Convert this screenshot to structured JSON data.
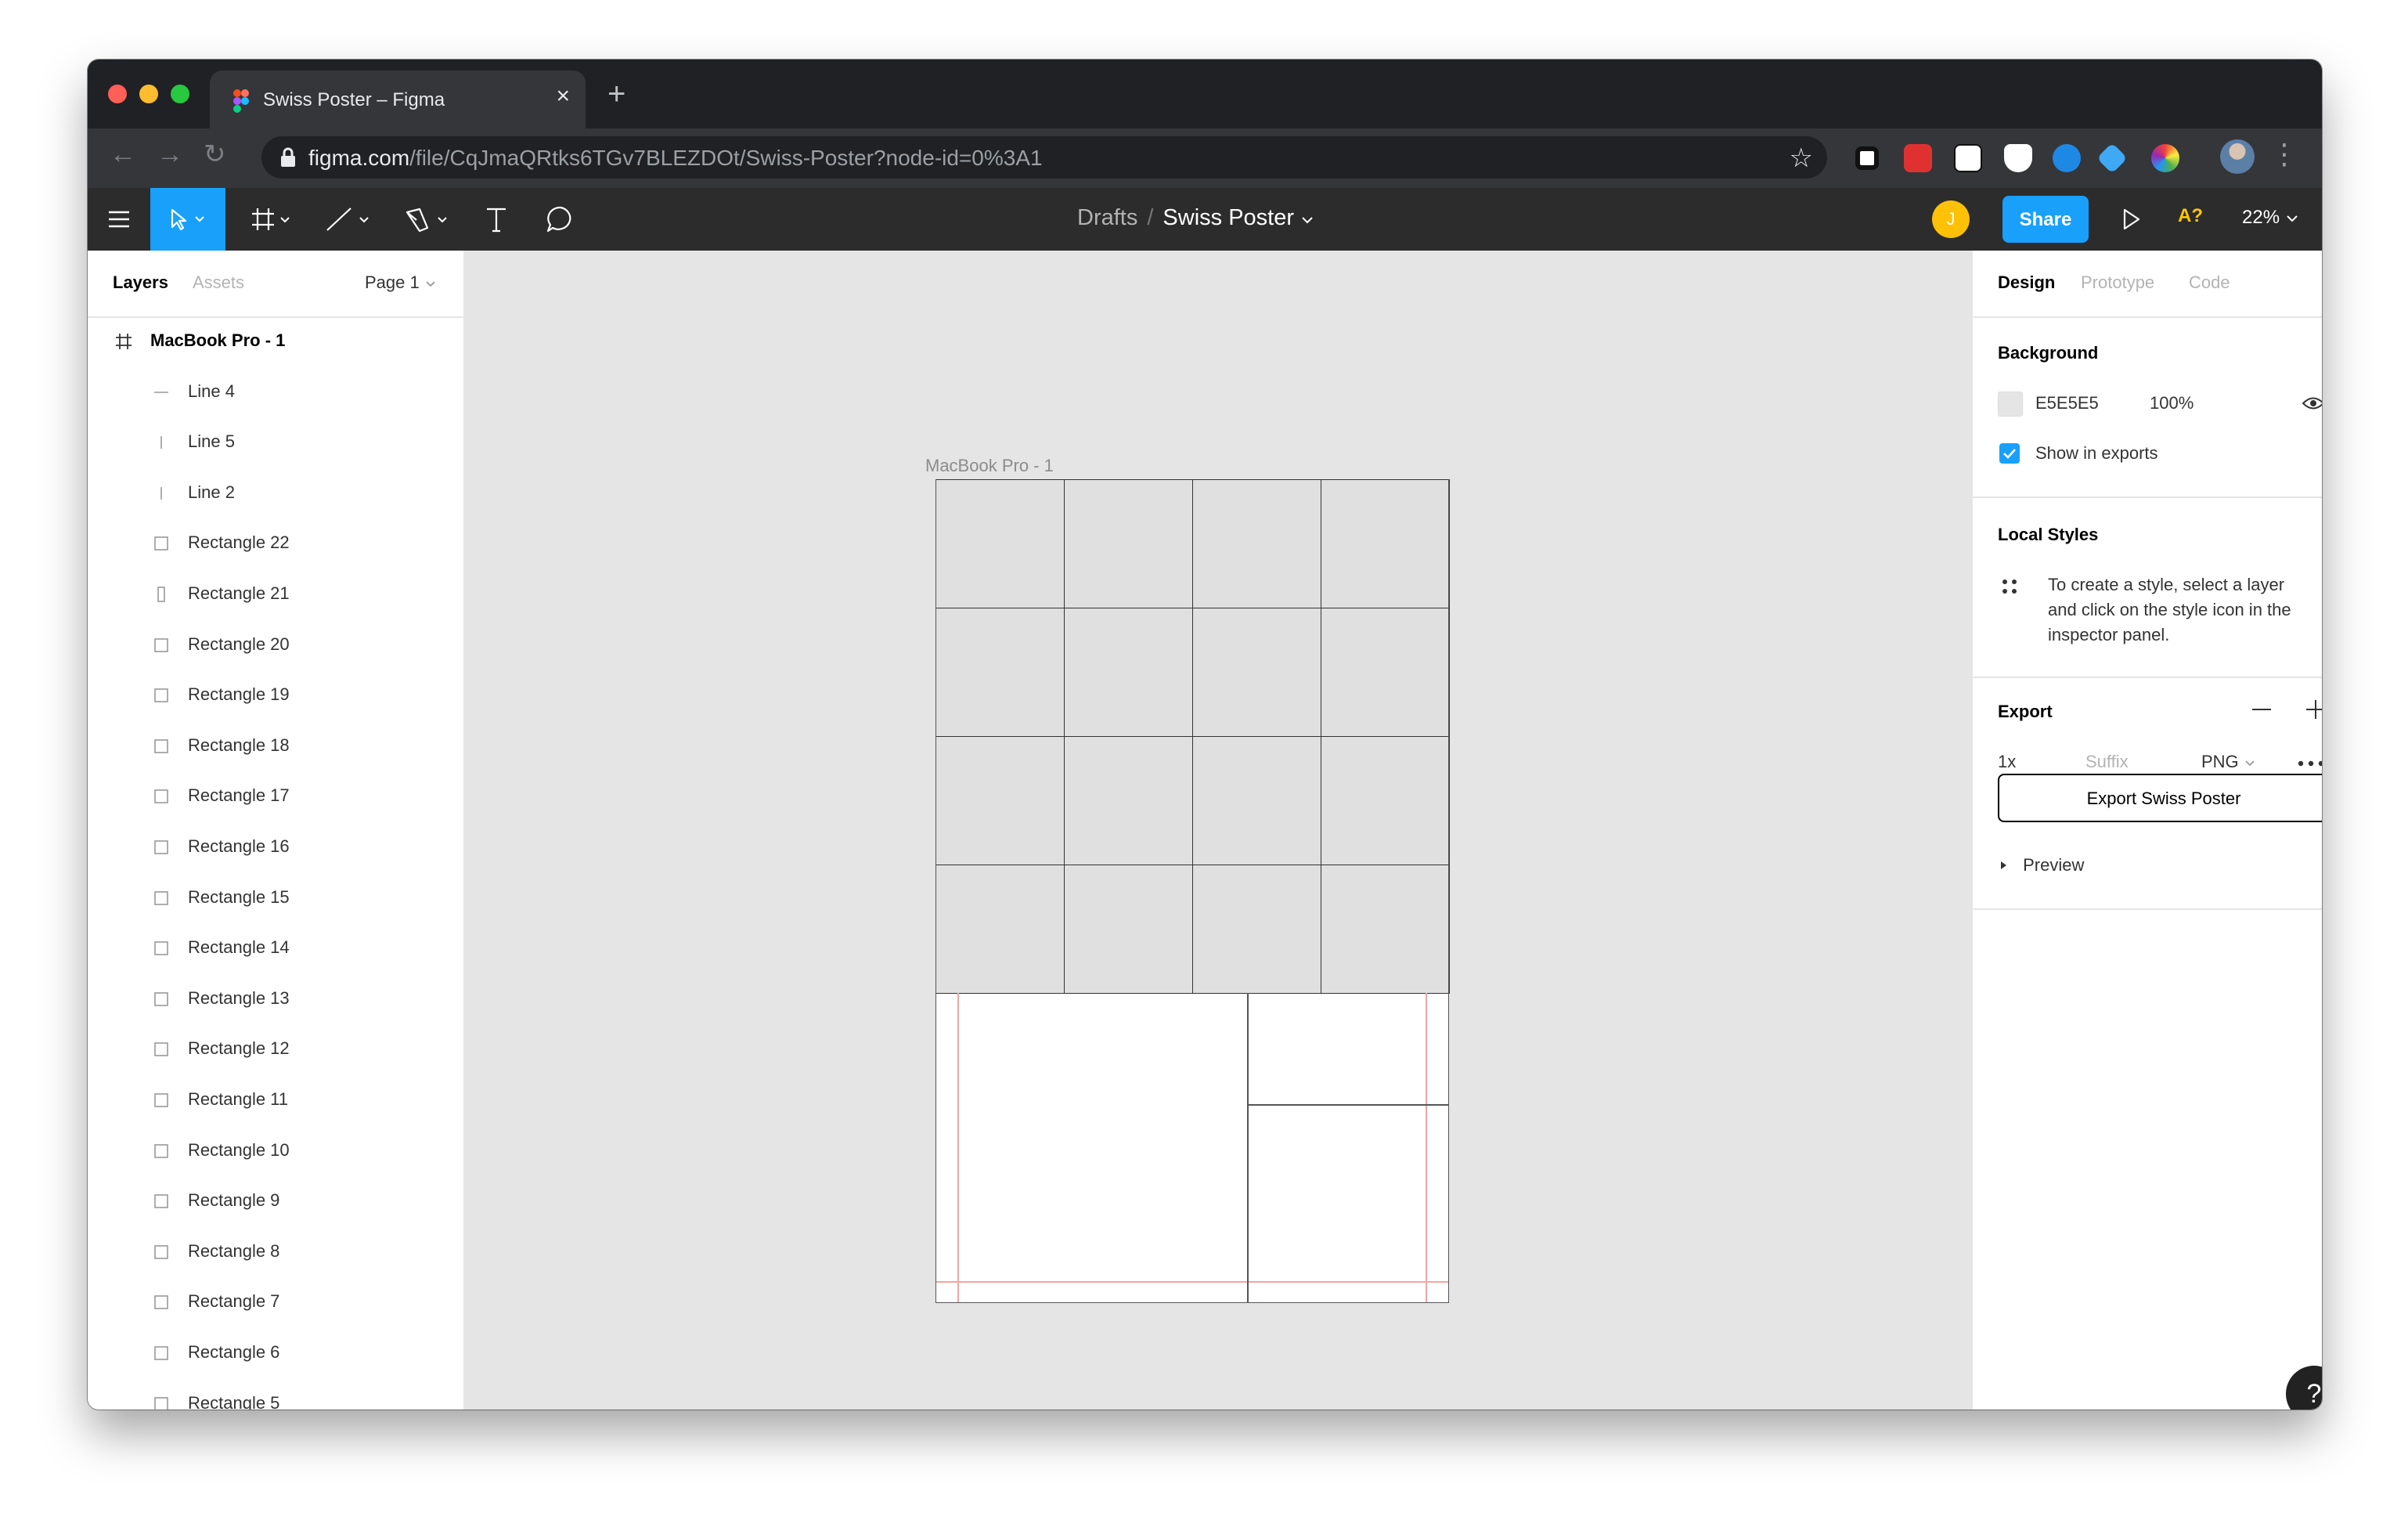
{
  "browser": {
    "tab_title": "Swiss Poster – Figma",
    "url_host": "figma.com",
    "url_path": "/file/CqJmaQRtks6TGv7BLEZDOt/Swiss-Poster?node-id=0%3A1"
  },
  "figma_toolbar": {
    "breadcrumb_parent": "Drafts",
    "breadcrumb_sep": "/",
    "file_name": "Swiss Poster",
    "user_initial": "J",
    "share_label": "Share",
    "missing_font_label": "A?",
    "zoom": "22%"
  },
  "left_panel": {
    "tabs": [
      "Layers",
      "Assets"
    ],
    "page": "Page 1",
    "layers": [
      {
        "label": "MacBook Pro - 1",
        "icon": "frame-icon"
      },
      {
        "label": "Line 4",
        "icon": "horizontal-line-icon"
      },
      {
        "label": "Line 5",
        "icon": "vertical-line-icon"
      },
      {
        "label": "Line 2",
        "icon": "vertical-line-icon"
      },
      {
        "label": "Rectangle 22",
        "icon": "rectangle-icon"
      },
      {
        "label": "Rectangle 21",
        "icon": "tall-rectangle-icon"
      },
      {
        "label": "Rectangle 20",
        "icon": "rectangle-icon"
      },
      {
        "label": "Rectangle 19",
        "icon": "rectangle-icon"
      },
      {
        "label": "Rectangle 18",
        "icon": "rectangle-icon"
      },
      {
        "label": "Rectangle 17",
        "icon": "rectangle-icon"
      },
      {
        "label": "Rectangle 16",
        "icon": "rectangle-icon"
      },
      {
        "label": "Rectangle 15",
        "icon": "rectangle-icon"
      },
      {
        "label": "Rectangle 14",
        "icon": "rectangle-icon"
      },
      {
        "label": "Rectangle 13",
        "icon": "rectangle-icon"
      },
      {
        "label": "Rectangle 12",
        "icon": "rectangle-icon"
      },
      {
        "label": "Rectangle 11",
        "icon": "rectangle-icon"
      },
      {
        "label": "Rectangle 10",
        "icon": "rectangle-icon"
      },
      {
        "label": "Rectangle 9",
        "icon": "rectangle-icon"
      },
      {
        "label": "Rectangle 8",
        "icon": "rectangle-icon"
      },
      {
        "label": "Rectangle 7",
        "icon": "rectangle-icon"
      },
      {
        "label": "Rectangle 6",
        "icon": "rectangle-icon"
      },
      {
        "label": "Rectangle 5",
        "icon": "rectangle-icon"
      }
    ]
  },
  "canvas": {
    "frame_label": "MacBook Pro - 1",
    "background": "#E5E5E5"
  },
  "right_panel": {
    "tabs": [
      "Design",
      "Prototype",
      "Code"
    ],
    "background": {
      "title": "Background",
      "hex": "E5E5E5",
      "opacity": "100%",
      "show_in_exports": "Show in exports"
    },
    "local_styles": {
      "title": "Local Styles",
      "hint": [
        "To create a style, select a layer",
        "and click on the style icon in the",
        "inspector panel."
      ]
    },
    "export": {
      "title": "Export",
      "scale": "1x",
      "suffix_placeholder": "Suffix",
      "format": "PNG",
      "button": "Export Swiss Poster",
      "preview": "Preview"
    }
  },
  "help_label": "?",
  "colors": {
    "figma_blue": "#18a0fb",
    "avatar_yellow": "#ffc107",
    "missing_font_yellow": "#ffc700"
  }
}
